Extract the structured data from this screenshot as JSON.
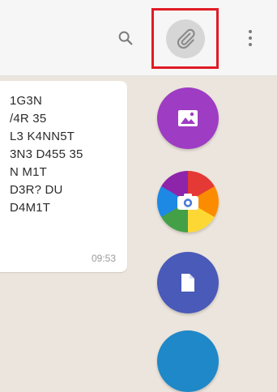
{
  "header": {
    "icons": {
      "search": "search-icon",
      "attach": "paperclip-icon",
      "menu": "more-vert-icon"
    },
    "highlight_color": "#e01b24"
  },
  "message": {
    "lines": [
      "1G3N",
      "/4R 35",
      "L3 K4NN5T",
      "3N3 D455 35",
      "N M1T",
      "D3R? DU",
      "D4M1T"
    ],
    "time": "09:53"
  },
  "attachment_options": {
    "gallery": {
      "icon": "image-icon",
      "color": "#9e3cc4"
    },
    "camera": {
      "icon": "camera-icon"
    },
    "document": {
      "icon": "document-icon",
      "color": "#4a5ab8"
    },
    "partial": {
      "color": "#1e88c8"
    }
  }
}
